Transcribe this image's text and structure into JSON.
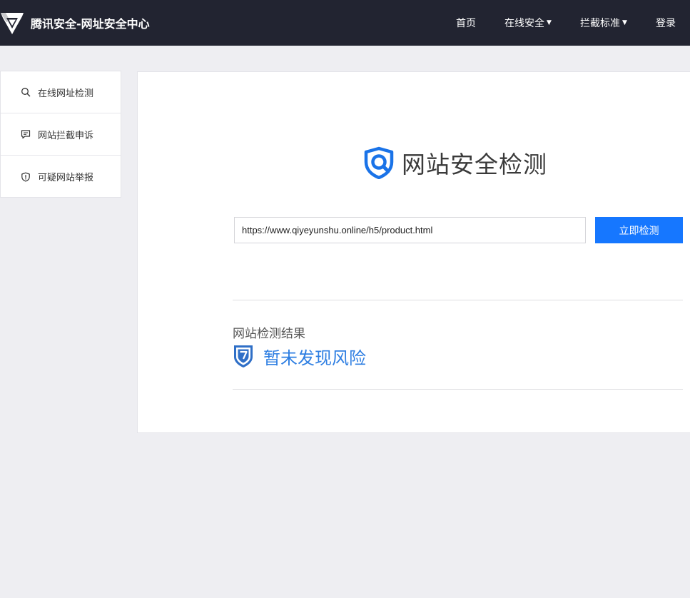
{
  "header": {
    "brand_title": "腾讯安全-网址安全中心",
    "nav": {
      "home": "首页",
      "online_security": "在线安全",
      "block_standard": "拦截标准",
      "login": "登录"
    }
  },
  "sidebar": {
    "items": [
      {
        "label": "在线网址检测",
        "icon": "search-icon"
      },
      {
        "label": "网站拦截申诉",
        "icon": "message-icon"
      },
      {
        "label": "可疑网站举报",
        "icon": "shield-alert-icon"
      }
    ]
  },
  "main": {
    "title": "网站安全检测",
    "url_value": "https://www.qiyeyunshu.online/h5/product.html",
    "check_button": "立即检测",
    "result_label": "网站检测结果",
    "result_text": "暂未发现风险"
  },
  "colors": {
    "topbar": "#222431",
    "accent": "#1677ff",
    "result_text": "#2f7fe2",
    "background": "#eeeef2"
  }
}
